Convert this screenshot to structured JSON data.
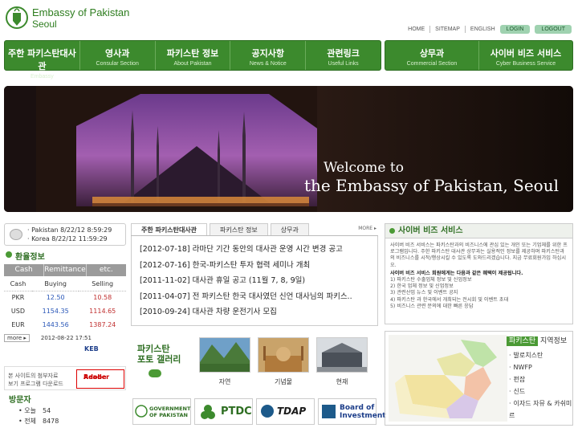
{
  "header": {
    "title_line1": "Embassy of Pakistan",
    "title_line2": "Seoul",
    "top_links": [
      "HOME",
      "SITEMAP",
      "ENGLISH"
    ],
    "login": "LOGIN",
    "logout": "LOGOUT"
  },
  "nav_left": [
    {
      "ko": "주한 파키스탄대사관",
      "en": "Embassy"
    },
    {
      "ko": "영사과",
      "en": "Consular Section"
    },
    {
      "ko": "파키스탄 정보",
      "en": "About Pakistan"
    },
    {
      "ko": "공지사항",
      "en": "News & Notice"
    },
    {
      "ko": "관련링크",
      "en": "Useful Links"
    }
  ],
  "nav_right": [
    {
      "ko": "상무과",
      "en": "Commercial Section"
    },
    {
      "ko": "사이버 비즈 서비스",
      "en": "Cyber Business Service"
    }
  ],
  "banner": {
    "line1": "Welcome to",
    "line2": "the Embassy of Pakistan, Seoul"
  },
  "clock": {
    "pakistan": "· Pakistan 8/22/12 8:59:29",
    "korea": "· Korea  8/22/12 11:59:29"
  },
  "exchange": {
    "title": "환율정보",
    "tabs": [
      "Cash",
      "Remittance",
      "etc."
    ],
    "headers": [
      "Cash",
      "Buying",
      "Selling"
    ],
    "rows": [
      {
        "cur": "PKR",
        "buy": "12.50",
        "sell": "10.58"
      },
      {
        "cur": "USD",
        "buy": "1154.35",
        "sell": "1114.65"
      },
      {
        "cur": "EUR",
        "buy": "1443.56",
        "sell": "1387.24"
      }
    ],
    "more": "more ▸",
    "updated": "2012-08-22 17:51",
    "bank": "KEB"
  },
  "adobe": {
    "text_line1": "본 사이트의 첨부자료",
    "text_line2": "보기 프로그램 다운로드",
    "badge_line1": "Adobe",
    "badge_line2": "Reader"
  },
  "visitors": {
    "title": "방문자",
    "today_label": "오늘",
    "today": "54",
    "total_label": "전체",
    "total": "8478"
  },
  "notice": {
    "tabs": [
      "주한 파키스탄대사관",
      "파키스탄 정보",
      "상무과"
    ],
    "more": "MORE ▸",
    "items": [
      "[2012-07-18] 라마단 기간 동안의 대사관 운영 시간 변경 공고",
      "[2012-07-16] 한국-파키스탄 투자 협력 세미나 개최",
      "[2011-11-02] 대사관 휴일 공고 (11월 7, 8, 9일)",
      "[2011-04-07] 전 파키스탄 한국 대사였던 신언 대사님의 파키스..",
      "[2010-09-24] 대사관 차량 운전기사 모집"
    ]
  },
  "gallery": {
    "title_line1": "파키스탄",
    "title_line2": "포토 갤러리",
    "labels": [
      "자연",
      "기념물",
      "현재"
    ]
  },
  "logos": {
    "gov_line1": "GOVERNMENT",
    "gov_line2": "OF PAKISTAN",
    "ptdc": "PTDC",
    "tdap": "TDAP",
    "boi_line1": "Board of",
    "boi_line2": "Investment"
  },
  "cyber": {
    "title": "사이버 비즈 서비스",
    "intro": "사이버 비즈 서비스는 파키스탄과의 비즈니스에 관심 있는 개인 또는 기업체를 위한 프로그램입니다. 주한 파키스탄 대사관 상무과는 실용적인 정보를 제공하며 파키스탄과의 비즈니스를 시작/행상시킬 수 있도록 도와드리겠습니다. 지금 무료회원가입 하십시오.",
    "benefits_title": "사이버 비즈 서비스 회원에게는 다음과 같은 혜택이 제공됩니다.",
    "benefits": [
      "1) 파키스탄 수출업체 정보 및 신업정보",
      "2) 한국 업체 정보 및 신업정보",
      "3) 관련산업 뉴스 및 이벤트 공지",
      "4) 파키스탄 과 한국에서 개최되는 전시회 및 이벤트 초대",
      "5) 비즈니스 관련 문의에 대한 빠른 응답"
    ]
  },
  "regions": {
    "title_highlight": "파키스탄",
    "title_rest": " 지역정보",
    "items": [
      "발로치스탄",
      "NWFP",
      "펀잡",
      "신드",
      "이자드 자뮤 & 카쉬미르"
    ]
  },
  "colors": {
    "brand_green": "#3c8a2d",
    "buy_blue": "#2a57b8",
    "sell_red": "#c03030"
  }
}
